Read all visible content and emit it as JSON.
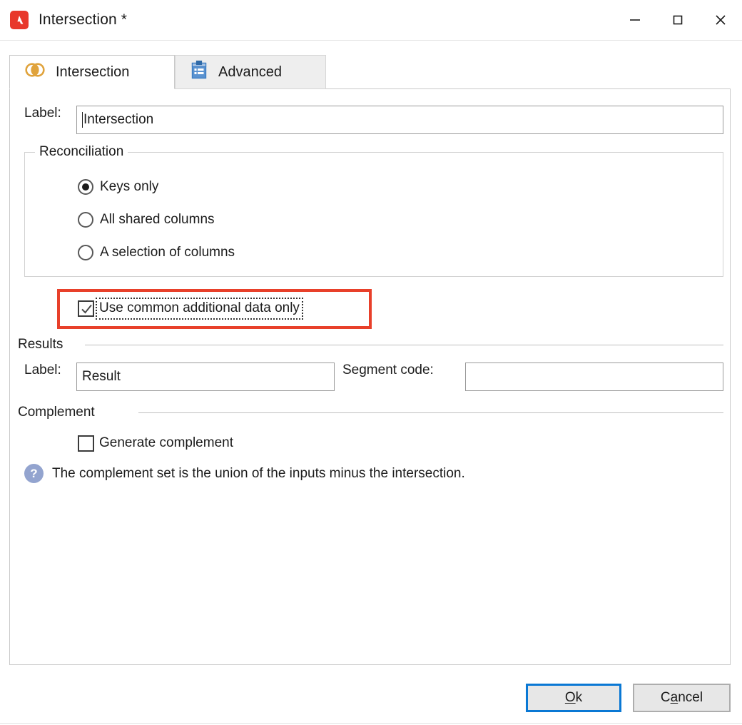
{
  "window": {
    "title": "Intersection *",
    "logo_icon": "adobe-logo-icon",
    "minimize_label": "Minimize",
    "maximize_label": "Maximize",
    "close_label": "Close"
  },
  "tabs": [
    {
      "label": "Intersection",
      "icon": "intersection-circles-icon",
      "active": true
    },
    {
      "label": "Advanced",
      "icon": "clipboard-icon",
      "active": false
    }
  ],
  "form": {
    "label_caption": "Label:",
    "label_value": "Intersection",
    "reconciliation": {
      "title": "Reconciliation",
      "options": [
        {
          "label": "Keys only",
          "selected": true
        },
        {
          "label": "All shared columns",
          "selected": false
        },
        {
          "label": "A selection of columns",
          "selected": false
        }
      ]
    },
    "common_data": {
      "label": "Use common additional data only",
      "checked": true,
      "focused": true,
      "highlighted": true
    },
    "results": {
      "title": "Results",
      "label_caption": "Label:",
      "label_value": "Result",
      "segment_code_caption": "Segment code:",
      "segment_code_value": ""
    },
    "complement": {
      "title": "Complement",
      "checkbox_label": "Generate complement",
      "checked": false,
      "help_icon": "help-question-icon",
      "help_text": "The complement set is the union of the inputs minus the intersection."
    }
  },
  "footer": {
    "ok_prefix": "",
    "ok_mnemonic": "O",
    "ok_suffix": "k",
    "cancel_prefix": "C",
    "cancel_mnemonic": "a",
    "cancel_suffix": "ncel"
  },
  "colors": {
    "accent_blue": "#0a78d4",
    "annotation_red": "#e8402a",
    "tab_icon_orange": "#e0a33c",
    "clipboard_blue": "#3d7ec4",
    "logo_red": "#e8382b",
    "help_blue": "#93a4cf"
  }
}
